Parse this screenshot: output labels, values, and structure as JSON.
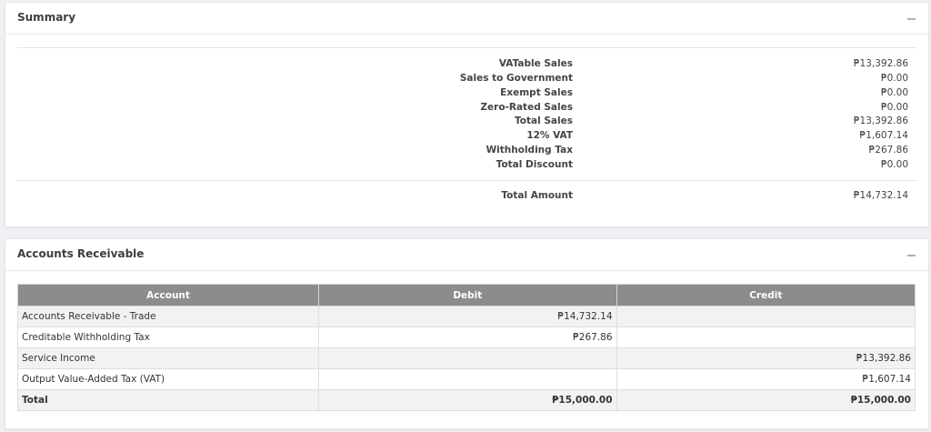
{
  "summary": {
    "title": "Summary",
    "rows": [
      {
        "label": "VATable Sales",
        "value": "₱13,392.86"
      },
      {
        "label": "Sales to Government",
        "value": "₱0.00"
      },
      {
        "label": "Exempt Sales",
        "value": "₱0.00"
      },
      {
        "label": "Zero-Rated Sales",
        "value": "₱0.00"
      },
      {
        "label": "Total Sales",
        "value": "₱13,392.86"
      },
      {
        "label": "12% VAT",
        "value": "₱1,607.14"
      },
      {
        "label": "Withholding Tax",
        "value": "₱267.86"
      },
      {
        "label": "Total Discount",
        "value": "₱0.00"
      }
    ],
    "total": {
      "label": "Total Amount",
      "value": "₱14,732.14"
    }
  },
  "accounts_receivable": {
    "title": "Accounts Receivable",
    "columns": [
      "Account",
      "Debit",
      "Credit"
    ],
    "rows": [
      {
        "account": "Accounts Receivable - Trade",
        "debit": "₱14,732.14",
        "credit": ""
      },
      {
        "account": "Creditable Withholding Tax",
        "debit": "₱267.86",
        "credit": ""
      },
      {
        "account": "Service Income",
        "debit": "",
        "credit": "₱13,392.86"
      },
      {
        "account": "Output Value-Added Tax (VAT)",
        "debit": "",
        "credit": "₱1,607.14"
      }
    ],
    "total": {
      "account": "Total",
      "debit": "₱15,000.00",
      "credit": "₱15,000.00"
    }
  },
  "icons": {
    "collapse": "minus-icon"
  },
  "colors": {
    "table_header": "#8c8c8c",
    "page_background": "#eef0f3"
  }
}
